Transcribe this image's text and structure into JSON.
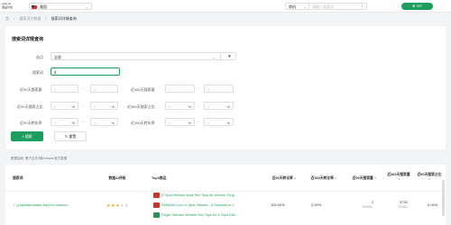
{
  "topbar": {
    "logo_line1": "ueie.ca",
    "logo_line2": "选品平台",
    "site_selector": "美国",
    "search_type": "商机",
    "search_placeholder": "请输入搜索词",
    "vip_label": "VIP"
  },
  "breadcrumb": [
    "首",
    "搜索词大数据",
    "搜索词详情查询"
  ],
  "filter": {
    "title": "搜索词详情查询",
    "site_label": "站点",
    "site_value": "全部",
    "keyword_label": "搜索词",
    "keyword_value": "g",
    "rows": [
      {
        "left_label": "近90天搜索量",
        "right_label": "近360天搜索量",
        "suffix": ""
      },
      {
        "left_label": "近90天搜索占比",
        "right_label": "近360天搜索占比",
        "suffix": "%"
      },
      {
        "left_label": "近90天转化率",
        "right_label": "近360天转化率",
        "suffix": "%"
      }
    ],
    "min_placeholder": "0",
    "search_button": "搜索",
    "reset_button": "重置"
  },
  "meta_text": "数据抽检: 基于过去3周Amazon官方数据",
  "table": {
    "headers": [
      "搜索词",
      "数据AI评级",
      "Top3商品",
      "近90天转化率",
      "近360天转化率",
      "近90天搜索量",
      "近360天搜索量",
      "近90天搜索占比"
    ],
    "rows": [
      {
        "keyword": "g spotstimulator toys for women",
        "rating": 3,
        "rating_max": 5,
        "products": [
          "G Spot Vibrator Adult Sex Toys for Women Tong",
          "SWAOM Coco G Spot Vibrator - 8 Seconds to C",
          "Finger Vibrator Women Sex Toys for G Spot Clito"
        ],
        "product_colors": [
          "#c0392b",
          "#c0392b",
          "#2e8b57"
        ],
        "conv90": "100.00%",
        "conv360": "2.92%",
        "search90": "2",
        "search90_sub": "-99.95%",
        "search360": "3732",
        "search360_sub": "76.28%",
        "share90": "0.04%"
      }
    ]
  }
}
